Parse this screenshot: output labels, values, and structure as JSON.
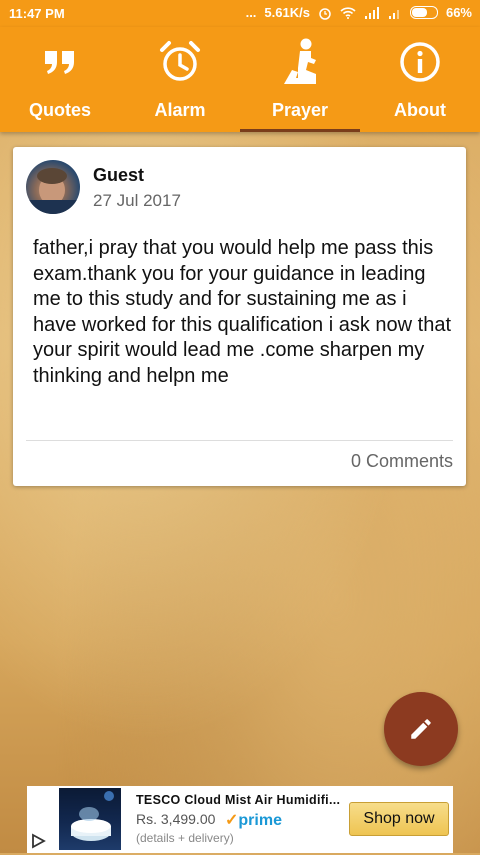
{
  "status_bar": {
    "time": "11:47 PM",
    "dots": "...",
    "speed": "5.61K/s",
    "battery": "66%",
    "icons": [
      "alarm-icon",
      "wifi-icon",
      "signal-icon",
      "signal-icon-2",
      "battery-icon"
    ]
  },
  "tabs": [
    {
      "label": "Quotes",
      "icon": "quote-icon"
    },
    {
      "label": "Alarm",
      "icon": "alarm-clock-icon"
    },
    {
      "label": "Prayer",
      "icon": "praying-person-icon",
      "selected": true
    },
    {
      "label": "About",
      "icon": "info-icon"
    }
  ],
  "post": {
    "user": "Guest",
    "date": "27 Jul 2017",
    "message": "father,i pray that you would help me pass this exam.thank you for your guidance in leading me to this study and for sustaining me as i have worked for this qualification i ask now that your spirit would lead me .come sharpen my thinking and helpn me",
    "comments": "0 Comments"
  },
  "fab": {
    "icon": "pencil-icon"
  },
  "ad": {
    "title": "TESCO Cloud Mist Air Humidifi...",
    "price": "Rs. 3,499.00",
    "prime": "prime",
    "details": "(details + delivery)",
    "button": "Shop now"
  },
  "colors": {
    "accent": "#f59a16",
    "indicator": "#7a3d1a",
    "fab": "#8c3a20",
    "prime": "#1a98d6"
  }
}
